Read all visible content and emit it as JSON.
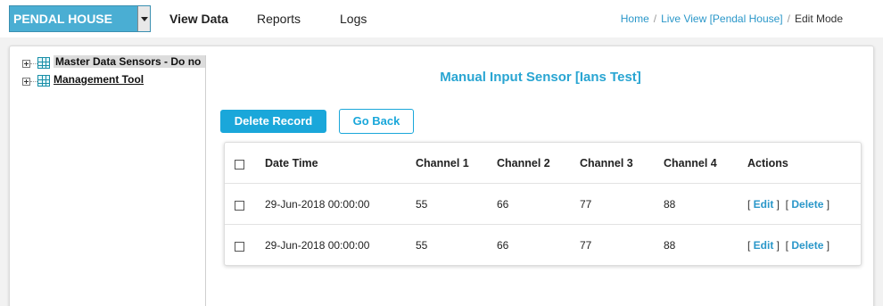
{
  "header": {
    "site_selector": "PENDAL HOUSE",
    "nav": [
      "View Data",
      "Reports",
      "Logs"
    ],
    "breadcrumb": {
      "home": "Home",
      "live_view": "Live View [Pendal House]",
      "current": "Edit Mode"
    }
  },
  "tree": {
    "items": [
      "Master Data Sensors - Do no",
      "Management Tool"
    ]
  },
  "main": {
    "title": "Manual Input Sensor [Ians Test]",
    "delete_record": "Delete Record",
    "go_back": "Go Back"
  },
  "table": {
    "columns": [
      "Date Time",
      "Channel 1",
      "Channel 2",
      "Channel 3",
      "Channel 4",
      "Actions"
    ],
    "rows": [
      {
        "datetime": "29-Jun-2018 00:00:00",
        "ch1": "55",
        "ch2": "66",
        "ch3": "77",
        "ch4": "88"
      },
      {
        "datetime": "29-Jun-2018 00:00:00",
        "ch1": "55",
        "ch2": "66",
        "ch3": "77",
        "ch4": "88"
      }
    ],
    "actions": {
      "edit": "Edit",
      "delete": "Delete"
    }
  },
  "colors": {
    "accent": "#1aa7da",
    "link": "#2a97c9",
    "site_selector_bg": "#4aaed3"
  }
}
